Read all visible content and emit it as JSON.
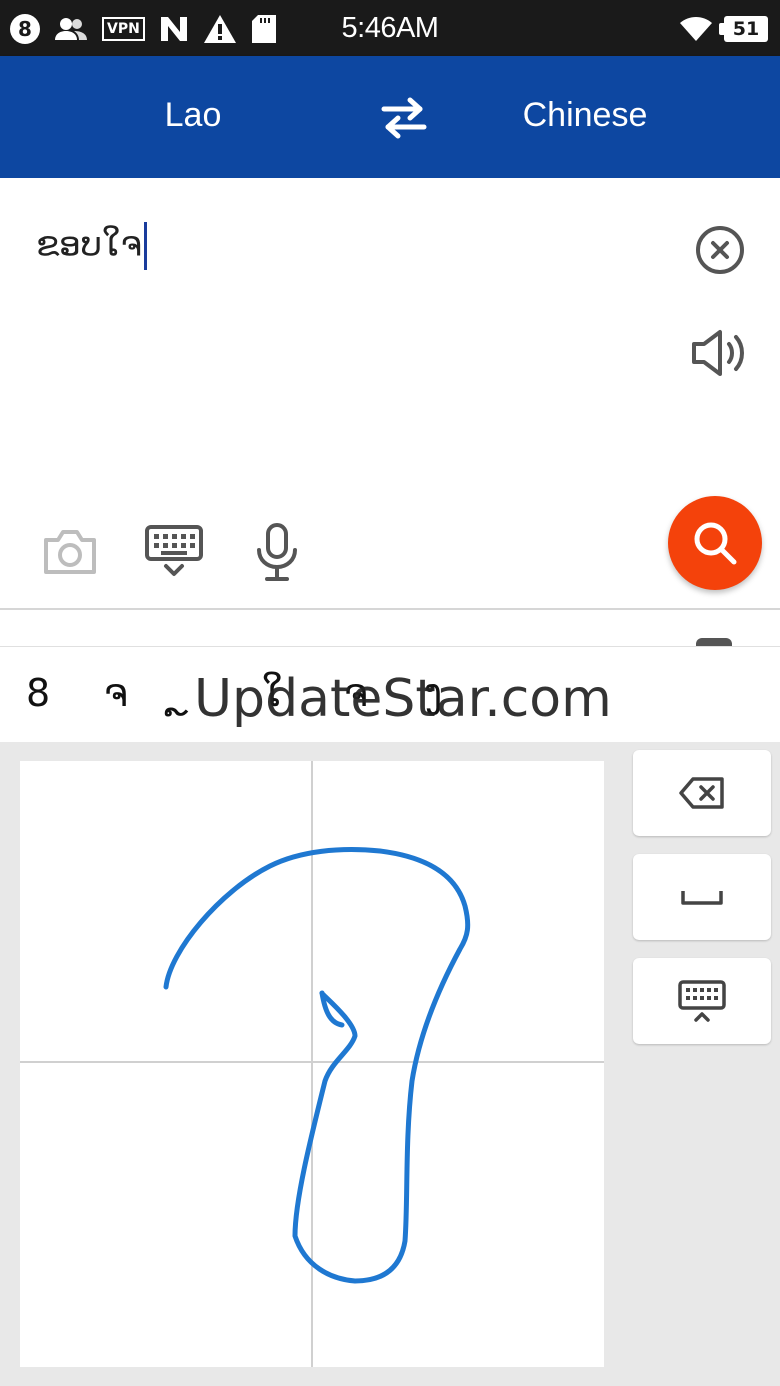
{
  "status_bar": {
    "notification_count": "8",
    "vpn_label": "VPN",
    "time": "5:46AM",
    "battery": "51",
    "icons": [
      "contacts-icon",
      "vpn-icon",
      "n-app-icon",
      "warning-icon",
      "sd-card-icon",
      "wifi-icon",
      "battery-icon"
    ]
  },
  "header": {
    "source_language": "Lao",
    "target_language": "Chinese",
    "swap_icon": "swap-arrows-icon",
    "background": "#0d47a1"
  },
  "input": {
    "text": "ຂອບໃຈ",
    "clear_icon": "clear-circle-icon",
    "speaker_icon": "speaker-icon"
  },
  "tools": {
    "camera_icon": "camera-icon",
    "keyboard_icon": "keyboard-hide-icon",
    "mic_icon": "microphone-icon",
    "search_icon": "search-icon",
    "search_color": "#f4420b"
  },
  "candidates": {
    "items": [
      "8",
      "ຈ",
      "ຼ",
      "ໃ",
      "ຈ",
      "ງ"
    ],
    "watermark": "UpdateStar.com"
  },
  "handwriting": {
    "stroke_color": "#1f78d1",
    "keys": [
      "backspace-icon",
      "space-icon",
      "keyboard-switch-icon"
    ]
  }
}
